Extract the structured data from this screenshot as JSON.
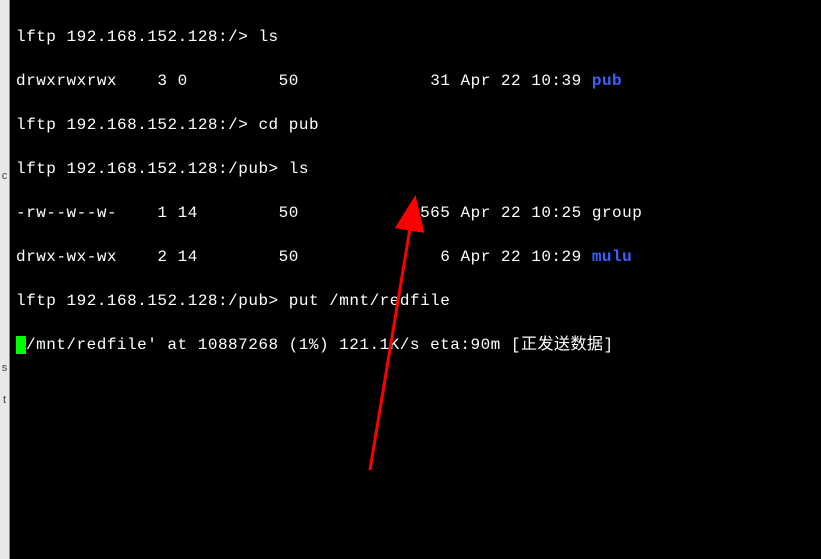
{
  "sidebar": {
    "chars": [
      "",
      "",
      "",
      "",
      "",
      "",
      "",
      "c",
      "",
      "",
      "",
      "",
      "",
      "",
      "",
      "",
      "s",
      "",
      "t",
      ""
    ]
  },
  "lines": {
    "l1_prompt": "lftp 192.168.152.128:/> ",
    "l1_cmd": "ls",
    "l2_perm": "drwxrwxrwx",
    "l2_links": "3",
    "l2_owner": "0",
    "l2_group": "50",
    "l2_size": "31",
    "l2_date": "Apr 22 10:39",
    "l2_name": "pub",
    "l3_prompt": "lftp 192.168.152.128:/> ",
    "l3_cmd": "cd pub",
    "l4_prompt": "lftp 192.168.152.128:/pub> ",
    "l4_cmd": "ls",
    "l5_perm": "-rw--w--w-",
    "l5_links": "1",
    "l5_owner": "14",
    "l5_group": "50",
    "l5_size": "565",
    "l5_date": "Apr 22 10:25",
    "l5_name": "group",
    "l6_perm": "drwx-wx-wx",
    "l6_links": "2",
    "l6_owner": "14",
    "l6_group": "50",
    "l6_size": "6",
    "l6_date": "Apr 22 10:29",
    "l6_name": "mulu",
    "l7_prompt": "lftp 192.168.152.128:/pub> ",
    "l7_cmd": "put /mnt/redfile",
    "l8_path": "/mnt/redfile' at ",
    "l8_bytes": "10887268",
    "l8_pct": " (1%) ",
    "l8_speed": "121.1K/s",
    "l8_eta": " eta:90m ",
    "l8_status": "[正发送数据]"
  }
}
